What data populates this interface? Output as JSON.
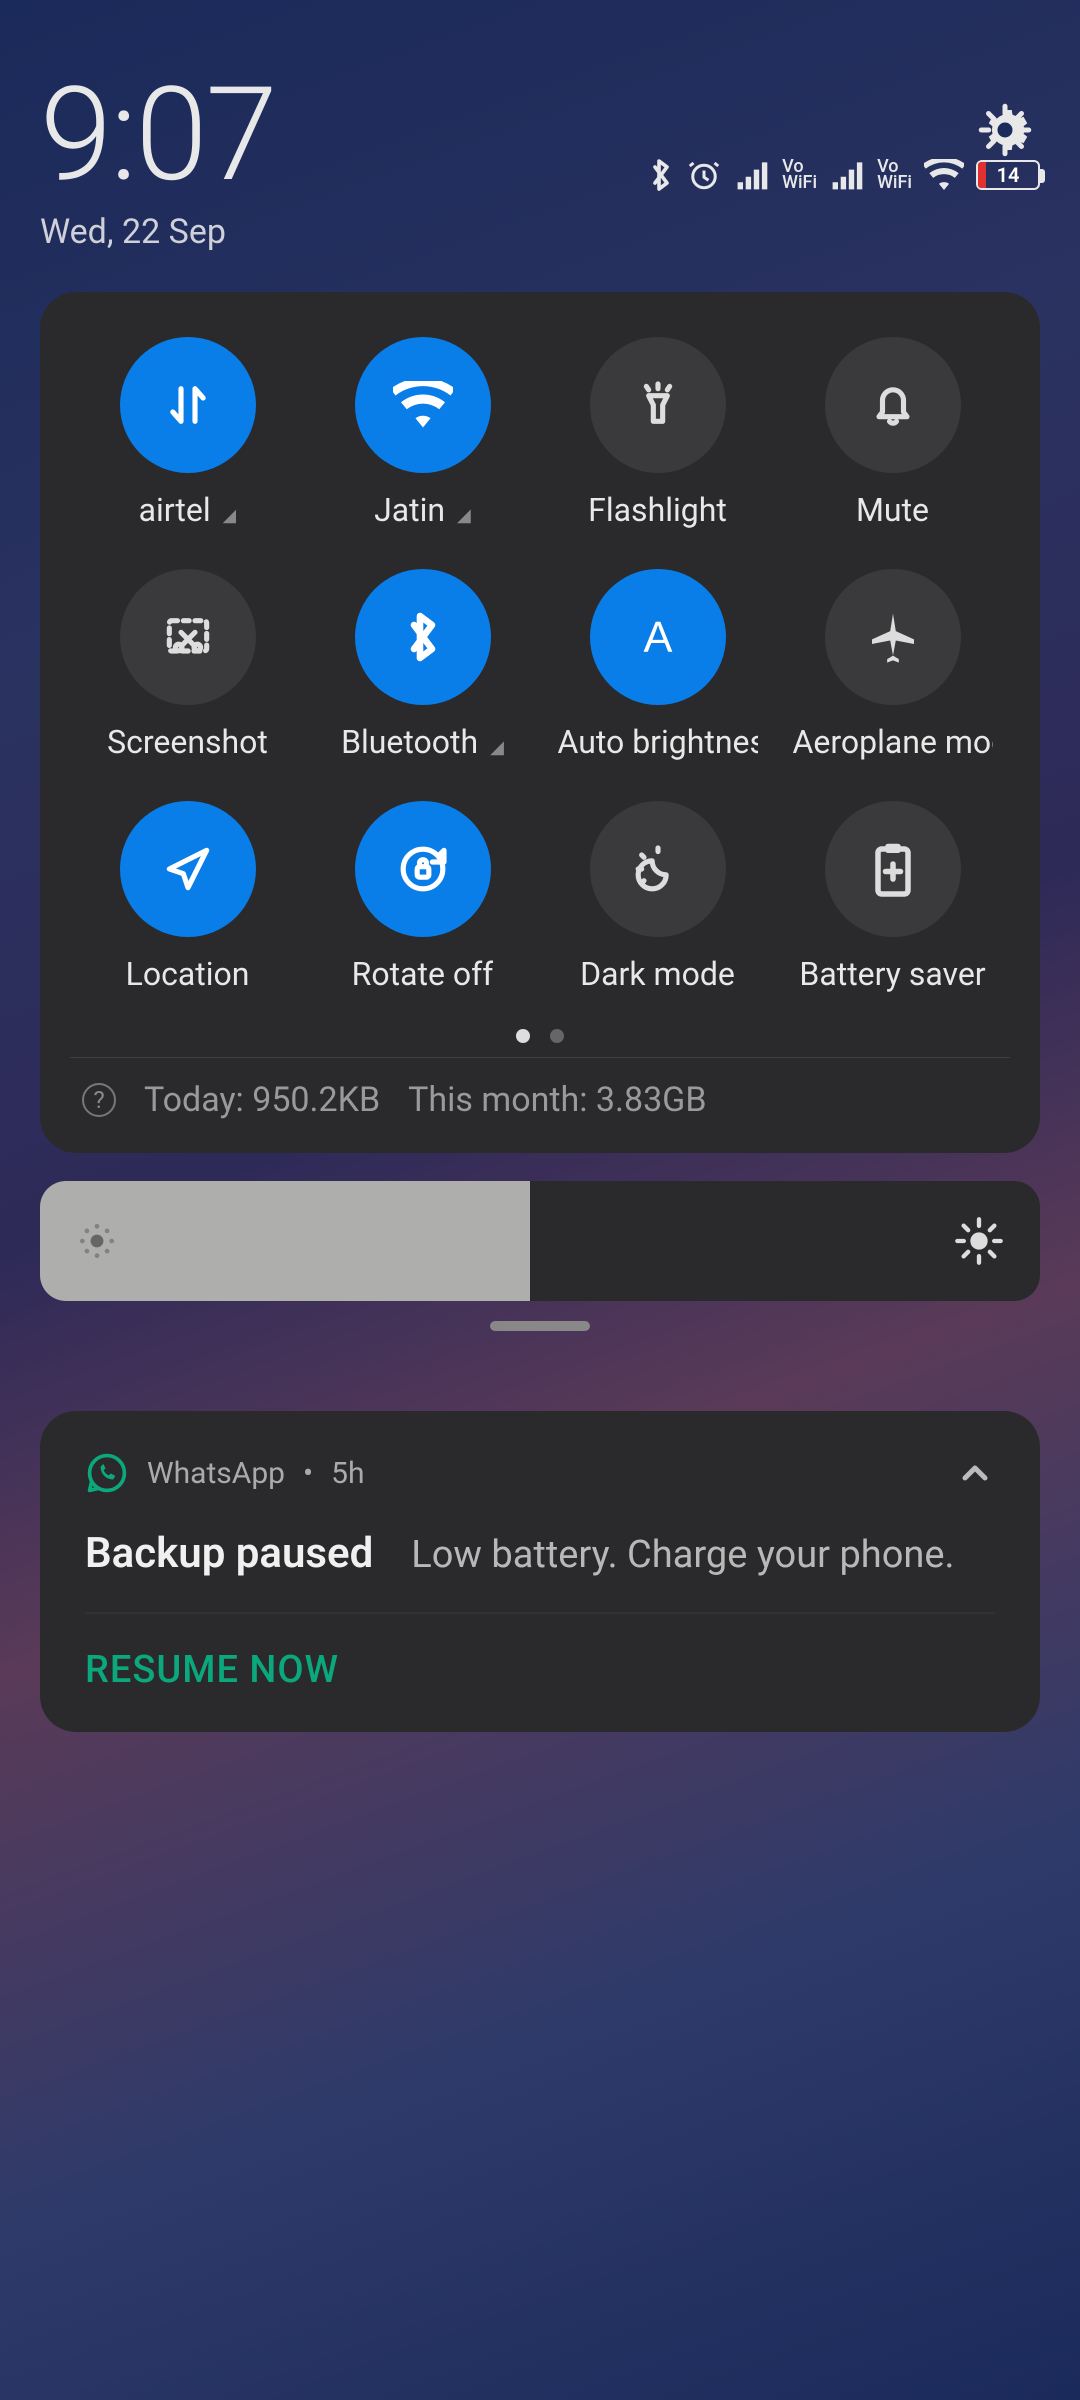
{
  "header": {
    "time": "9:07",
    "date": "Wed, 22 Sep"
  },
  "status": {
    "battery_percent": "14",
    "bluetooth": true,
    "alarm": true,
    "vowifi_label_top": "Vo",
    "vowifi_label_bottom": "WiFi"
  },
  "quick_settings": [
    {
      "id": "mobile-data",
      "label": "airtel",
      "caret": true,
      "on": true,
      "icon": "data-arrows"
    },
    {
      "id": "wifi",
      "label": "Jatin",
      "caret": true,
      "on": true,
      "icon": "wifi"
    },
    {
      "id": "flashlight",
      "label": "Flashlight",
      "caret": false,
      "on": false,
      "icon": "torch"
    },
    {
      "id": "mute",
      "label": "Mute",
      "caret": false,
      "on": false,
      "icon": "bell"
    },
    {
      "id": "screenshot",
      "label": "Screenshot",
      "caret": false,
      "on": false,
      "icon": "scissors"
    },
    {
      "id": "bluetooth",
      "label": "Bluetooth",
      "caret": true,
      "on": true,
      "icon": "bluetooth"
    },
    {
      "id": "auto-brightness",
      "label": "Auto brightness",
      "caret": false,
      "on": true,
      "icon": "letter-a"
    },
    {
      "id": "aeroplane",
      "label": "Aeroplane mode",
      "caret": false,
      "on": false,
      "icon": "plane"
    },
    {
      "id": "location",
      "label": "Location",
      "caret": false,
      "on": true,
      "icon": "nav-arrow"
    },
    {
      "id": "rotate",
      "label": "Rotate off",
      "caret": false,
      "on": true,
      "icon": "rotate-lock"
    },
    {
      "id": "darkmode",
      "label": "Dark mode",
      "caret": false,
      "on": false,
      "icon": "moon-sun"
    },
    {
      "id": "battery-saver",
      "label": "Battery saver",
      "caret": false,
      "on": false,
      "icon": "battery-plus"
    }
  ],
  "usage": {
    "today_label": "Today: 950.2KB",
    "month_label": "This month: 3.83GB"
  },
  "brightness": {
    "percent": 49
  },
  "notification": {
    "app": "WhatsApp",
    "sep": "•",
    "age": "5h",
    "title": "Backup paused",
    "text": "Low battery. Charge your phone.",
    "action": "RESUME NOW"
  },
  "colors": {
    "accent_on": "#0a7ee8",
    "whatsapp": "#0aa87c"
  }
}
